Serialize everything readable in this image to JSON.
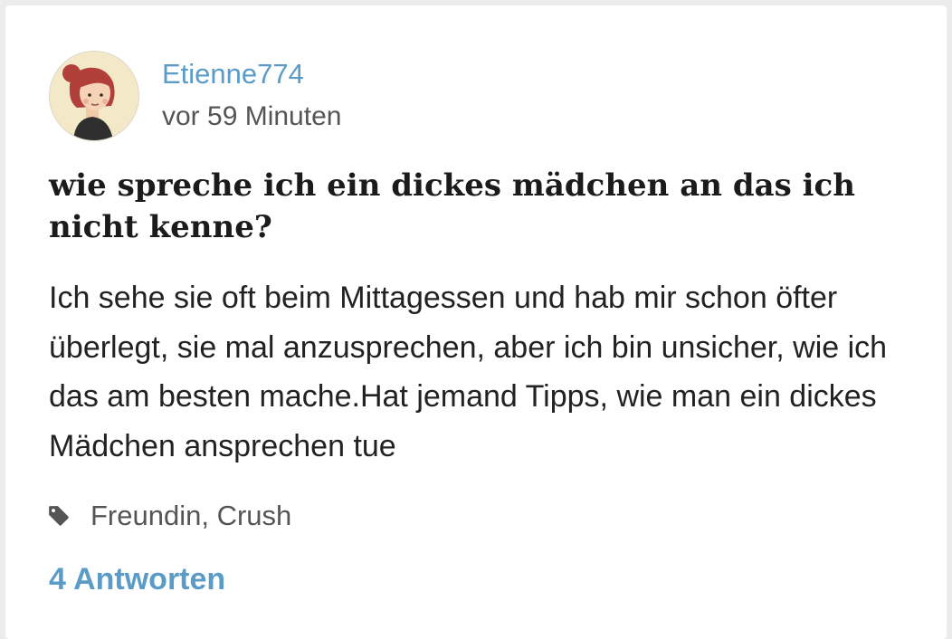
{
  "post": {
    "username": "Etienne774",
    "time_ago": "vor 59 Minuten",
    "title": "wie spreche ich ein dickes mädchen an das ich nicht kenne?",
    "body": "Ich sehe sie oft beim Mittagessen und hab mir schon öfter überlegt, sie mal anzusprechen, aber ich bin unsicher, wie ich das am besten mache.Hat jemand Tipps, wie man ein dickes Mädchen ansprechen tue",
    "tags_text": "Freundin, Crush",
    "tag_icon": "tag-icon",
    "answers_label": "4 Antworten",
    "avatar_icon": "avatar-woman-red-hair"
  },
  "colors": {
    "link": "#5a9cc7",
    "text": "#222222",
    "muted": "#555555",
    "background": "#ffffff"
  }
}
